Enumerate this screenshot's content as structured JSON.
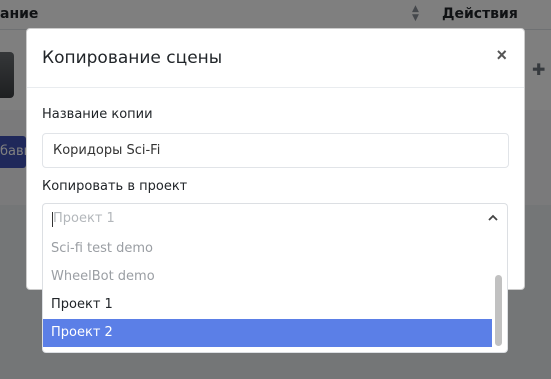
{
  "background": {
    "table_header": {
      "left_col_fragment": "ание",
      "actions_label": "Действия",
      "sort_icon": "sort-icon"
    },
    "add_button_fragment": "бави",
    "puzzle_icon": "puzzle-icon"
  },
  "modal": {
    "title": "Копирование сцены",
    "close_symbol": "×",
    "name_label": "Название копии",
    "name_value": "Коридоры Sci-Fi",
    "project_label": "Копировать в проект",
    "project_placeholder": "Проект 1",
    "options": [
      {
        "label": "Sci-fi test demo",
        "state": "disabled"
      },
      {
        "label": "WheelBot demo",
        "state": "disabled"
      },
      {
        "label": "Проект 1",
        "state": "normal"
      },
      {
        "label": "Проект 2",
        "state": "selected"
      }
    ]
  },
  "colors": {
    "selected_option": "#5b7fe7",
    "add_button": "#3f51b5"
  }
}
